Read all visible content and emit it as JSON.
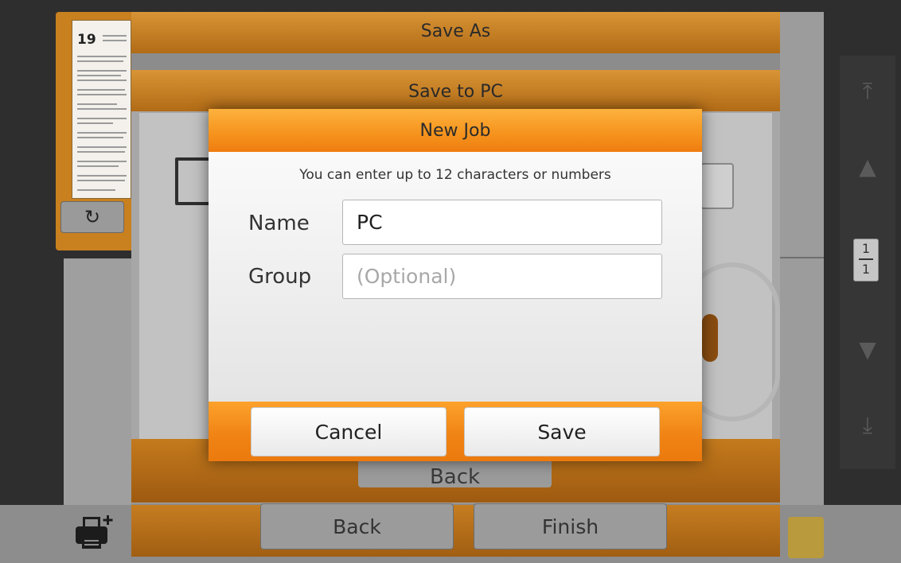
{
  "background": {
    "save_as_title": "Save As",
    "save_to_pc_title": "Save to PC",
    "thumbnail_page_number": "19",
    "back_ghost_label": "Back",
    "bottom_back_label": "Back",
    "bottom_finish_label": "Finish",
    "page_indicator": {
      "current": "1",
      "total": "1"
    },
    "icons": [
      "rotate-icon",
      "monitor-icon",
      "jump-top-icon",
      "page-up-icon",
      "page-down-icon",
      "jump-bottom-icon",
      "printer-add-icon"
    ]
  },
  "dialog": {
    "title": "New Job",
    "hint": "You can enter up to 12 characters or numbers",
    "name_label": "Name",
    "name_value": "PC",
    "group_label": "Group",
    "group_placeholder": "(Optional)",
    "cancel_label": "Cancel",
    "save_label": "Save"
  },
  "colors": {
    "accent_orange": "#f5921c",
    "dim_orange": "#b26b16",
    "overlay_gray": "#8c8c8c"
  }
}
